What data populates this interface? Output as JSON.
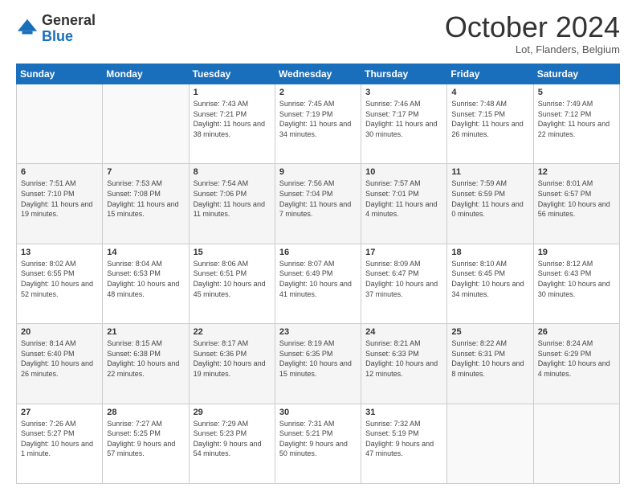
{
  "header": {
    "logo_general": "General",
    "logo_blue": "Blue",
    "month_title": "October 2024",
    "location": "Lot, Flanders, Belgium"
  },
  "weekdays": [
    "Sunday",
    "Monday",
    "Tuesday",
    "Wednesday",
    "Thursday",
    "Friday",
    "Saturday"
  ],
  "weeks": [
    [
      {
        "day": "",
        "sunrise": "",
        "sunset": "",
        "daylight": ""
      },
      {
        "day": "",
        "sunrise": "",
        "sunset": "",
        "daylight": ""
      },
      {
        "day": "1",
        "sunrise": "Sunrise: 7:43 AM",
        "sunset": "Sunset: 7:21 PM",
        "daylight": "Daylight: 11 hours and 38 minutes."
      },
      {
        "day": "2",
        "sunrise": "Sunrise: 7:45 AM",
        "sunset": "Sunset: 7:19 PM",
        "daylight": "Daylight: 11 hours and 34 minutes."
      },
      {
        "day": "3",
        "sunrise": "Sunrise: 7:46 AM",
        "sunset": "Sunset: 7:17 PM",
        "daylight": "Daylight: 11 hours and 30 minutes."
      },
      {
        "day": "4",
        "sunrise": "Sunrise: 7:48 AM",
        "sunset": "Sunset: 7:15 PM",
        "daylight": "Daylight: 11 hours and 26 minutes."
      },
      {
        "day": "5",
        "sunrise": "Sunrise: 7:49 AM",
        "sunset": "Sunset: 7:12 PM",
        "daylight": "Daylight: 11 hours and 22 minutes."
      }
    ],
    [
      {
        "day": "6",
        "sunrise": "Sunrise: 7:51 AM",
        "sunset": "Sunset: 7:10 PM",
        "daylight": "Daylight: 11 hours and 19 minutes."
      },
      {
        "day": "7",
        "sunrise": "Sunrise: 7:53 AM",
        "sunset": "Sunset: 7:08 PM",
        "daylight": "Daylight: 11 hours and 15 minutes."
      },
      {
        "day": "8",
        "sunrise": "Sunrise: 7:54 AM",
        "sunset": "Sunset: 7:06 PM",
        "daylight": "Daylight: 11 hours and 11 minutes."
      },
      {
        "day": "9",
        "sunrise": "Sunrise: 7:56 AM",
        "sunset": "Sunset: 7:04 PM",
        "daylight": "Daylight: 11 hours and 7 minutes."
      },
      {
        "day": "10",
        "sunrise": "Sunrise: 7:57 AM",
        "sunset": "Sunset: 7:01 PM",
        "daylight": "Daylight: 11 hours and 4 minutes."
      },
      {
        "day": "11",
        "sunrise": "Sunrise: 7:59 AM",
        "sunset": "Sunset: 6:59 PM",
        "daylight": "Daylight: 11 hours and 0 minutes."
      },
      {
        "day": "12",
        "sunrise": "Sunrise: 8:01 AM",
        "sunset": "Sunset: 6:57 PM",
        "daylight": "Daylight: 10 hours and 56 minutes."
      }
    ],
    [
      {
        "day": "13",
        "sunrise": "Sunrise: 8:02 AM",
        "sunset": "Sunset: 6:55 PM",
        "daylight": "Daylight: 10 hours and 52 minutes."
      },
      {
        "day": "14",
        "sunrise": "Sunrise: 8:04 AM",
        "sunset": "Sunset: 6:53 PM",
        "daylight": "Daylight: 10 hours and 48 minutes."
      },
      {
        "day": "15",
        "sunrise": "Sunrise: 8:06 AM",
        "sunset": "Sunset: 6:51 PM",
        "daylight": "Daylight: 10 hours and 45 minutes."
      },
      {
        "day": "16",
        "sunrise": "Sunrise: 8:07 AM",
        "sunset": "Sunset: 6:49 PM",
        "daylight": "Daylight: 10 hours and 41 minutes."
      },
      {
        "day": "17",
        "sunrise": "Sunrise: 8:09 AM",
        "sunset": "Sunset: 6:47 PM",
        "daylight": "Daylight: 10 hours and 37 minutes."
      },
      {
        "day": "18",
        "sunrise": "Sunrise: 8:10 AM",
        "sunset": "Sunset: 6:45 PM",
        "daylight": "Daylight: 10 hours and 34 minutes."
      },
      {
        "day": "19",
        "sunrise": "Sunrise: 8:12 AM",
        "sunset": "Sunset: 6:43 PM",
        "daylight": "Daylight: 10 hours and 30 minutes."
      }
    ],
    [
      {
        "day": "20",
        "sunrise": "Sunrise: 8:14 AM",
        "sunset": "Sunset: 6:40 PM",
        "daylight": "Daylight: 10 hours and 26 minutes."
      },
      {
        "day": "21",
        "sunrise": "Sunrise: 8:15 AM",
        "sunset": "Sunset: 6:38 PM",
        "daylight": "Daylight: 10 hours and 22 minutes."
      },
      {
        "day": "22",
        "sunrise": "Sunrise: 8:17 AM",
        "sunset": "Sunset: 6:36 PM",
        "daylight": "Daylight: 10 hours and 19 minutes."
      },
      {
        "day": "23",
        "sunrise": "Sunrise: 8:19 AM",
        "sunset": "Sunset: 6:35 PM",
        "daylight": "Daylight: 10 hours and 15 minutes."
      },
      {
        "day": "24",
        "sunrise": "Sunrise: 8:21 AM",
        "sunset": "Sunset: 6:33 PM",
        "daylight": "Daylight: 10 hours and 12 minutes."
      },
      {
        "day": "25",
        "sunrise": "Sunrise: 8:22 AM",
        "sunset": "Sunset: 6:31 PM",
        "daylight": "Daylight: 10 hours and 8 minutes."
      },
      {
        "day": "26",
        "sunrise": "Sunrise: 8:24 AM",
        "sunset": "Sunset: 6:29 PM",
        "daylight": "Daylight: 10 hours and 4 minutes."
      }
    ],
    [
      {
        "day": "27",
        "sunrise": "Sunrise: 7:26 AM",
        "sunset": "Sunset: 5:27 PM",
        "daylight": "Daylight: 10 hours and 1 minute."
      },
      {
        "day": "28",
        "sunrise": "Sunrise: 7:27 AM",
        "sunset": "Sunset: 5:25 PM",
        "daylight": "Daylight: 9 hours and 57 minutes."
      },
      {
        "day": "29",
        "sunrise": "Sunrise: 7:29 AM",
        "sunset": "Sunset: 5:23 PM",
        "daylight": "Daylight: 9 hours and 54 minutes."
      },
      {
        "day": "30",
        "sunrise": "Sunrise: 7:31 AM",
        "sunset": "Sunset: 5:21 PM",
        "daylight": "Daylight: 9 hours and 50 minutes."
      },
      {
        "day": "31",
        "sunrise": "Sunrise: 7:32 AM",
        "sunset": "Sunset: 5:19 PM",
        "daylight": "Daylight: 9 hours and 47 minutes."
      },
      {
        "day": "",
        "sunrise": "",
        "sunset": "",
        "daylight": ""
      },
      {
        "day": "",
        "sunrise": "",
        "sunset": "",
        "daylight": ""
      }
    ]
  ]
}
